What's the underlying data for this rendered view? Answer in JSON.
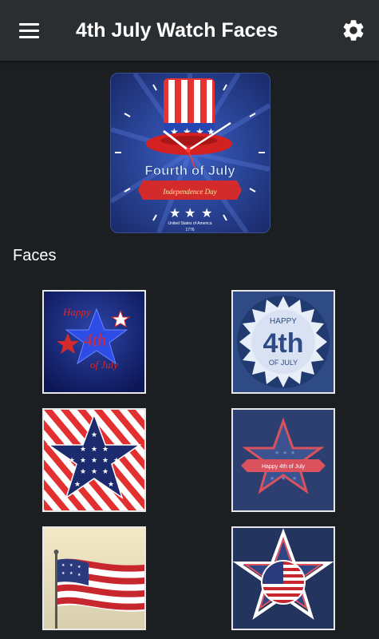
{
  "appbar": {
    "title": "4th July Watch Faces"
  },
  "preview": {
    "headline": "Fourth of July",
    "ribbon": "Independence Day",
    "caption": "United States of America",
    "year": "1776"
  },
  "section": {
    "label": "Faces"
  },
  "faces": [
    {
      "line1": "Happy",
      "line2": "4th",
      "line3": "of July"
    },
    {
      "line1": "HAPPY",
      "line2": "4th",
      "line3": "OF JULY"
    },
    {
      "label": ""
    },
    {
      "ribbon": "Happy 4th of July"
    },
    {
      "label": ""
    },
    {
      "label": ""
    }
  ],
  "colors": {
    "background": "#1c1f21",
    "appbar": "#2b2e30",
    "navy": "#233a82",
    "red": "#d32b2b"
  }
}
